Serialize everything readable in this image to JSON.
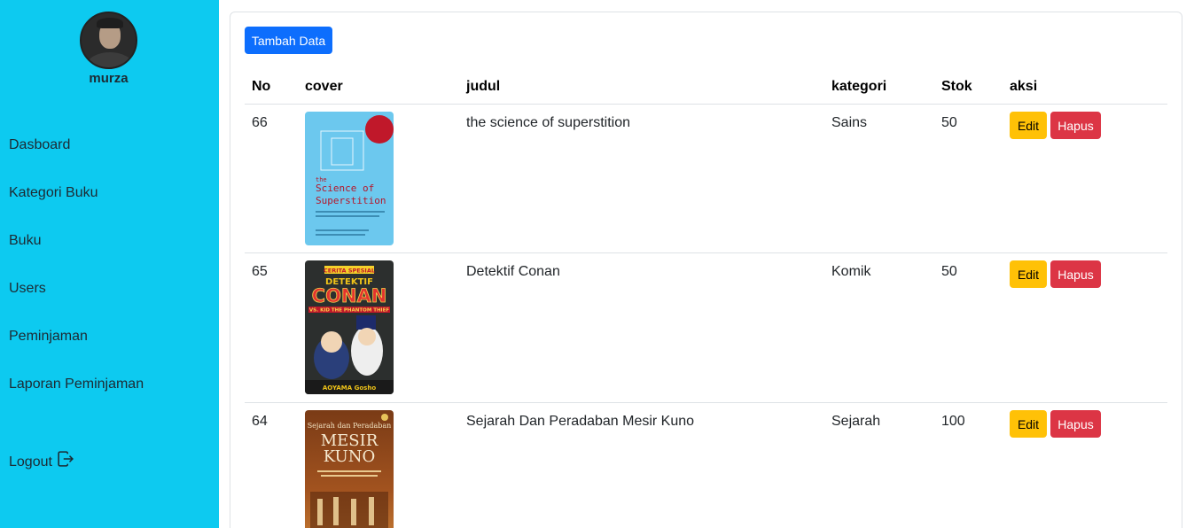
{
  "sidebar": {
    "username": "murza",
    "items": [
      {
        "label": "Dasboard"
      },
      {
        "label": "Kategori Buku"
      },
      {
        "label": "Buku"
      },
      {
        "label": "Users"
      },
      {
        "label": "Peminjaman"
      },
      {
        "label": "Laporan Peminjaman"
      }
    ],
    "logout_label": "Logout",
    "logout_icon": "logout-icon"
  },
  "main": {
    "add_button_label": "Tambah Data",
    "table": {
      "headers": [
        "No",
        "cover",
        "judul",
        "kategori",
        "Stok",
        "aksi"
      ],
      "rows": [
        {
          "no": "66",
          "judul": "the science of superstition",
          "kategori": "Sains",
          "stok": "50",
          "cover_text": {
            "title_line1": "the",
            "title_line2": "Science of",
            "title_line3": "Superstition"
          }
        },
        {
          "no": "65",
          "judul": "Detektif Conan",
          "kategori": "Komik",
          "stok": "50",
          "cover_text": {
            "banner": "CERITA SPESIAL",
            "title_line1": "DETEKTIF",
            "title_line2": "CONAN",
            "subtitle": "VS. KID THE PHANTOM THIEF",
            "author": "AOYAMA Gosho"
          }
        },
        {
          "no": "64",
          "judul": "Sejarah Dan Peradaban Mesir Kuno",
          "kategori": "Sejarah",
          "stok": "100",
          "cover_text": {
            "title_line1": "Sejarah dan Peradaban",
            "title_line2": "MESIR",
            "title_line3": "KUNO"
          }
        }
      ],
      "edit_label": "Edit",
      "delete_label": "Hapus"
    }
  },
  "colors": {
    "sidebar_bg": "#0dcaf0",
    "primary": "#0d6efd",
    "warning": "#ffc107",
    "danger": "#dc3545"
  }
}
